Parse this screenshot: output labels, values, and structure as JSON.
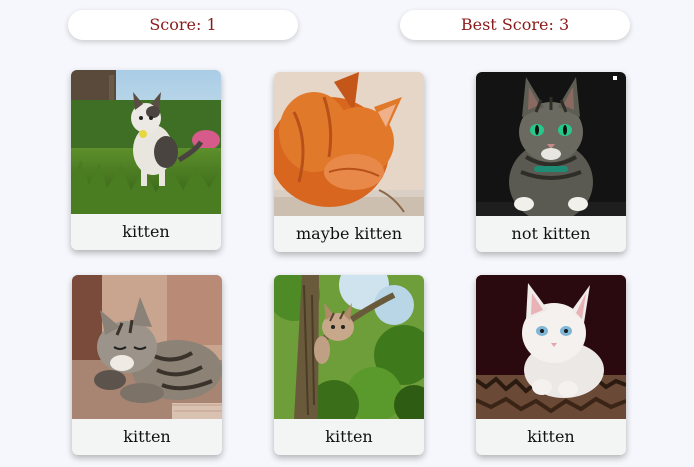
{
  "header": {
    "score_text": "Score: 1",
    "best_score_text": "Best Score: 3"
  },
  "cards": [
    {
      "label": "kitten",
      "image": "kitten-on-grass-photo"
    },
    {
      "label": "maybe kitten",
      "image": "orange-cat-hiding-face-photo"
    },
    {
      "label": "not kitten",
      "image": "tabby-cat-green-eyes-photo"
    },
    {
      "label": "kitten",
      "image": "sleeping-tabby-kitten-photo"
    },
    {
      "label": "kitten",
      "image": "kitten-in-tree-photo"
    },
    {
      "label": "kitten",
      "image": "white-kitten-blue-eyes-photo"
    }
  ],
  "colors": {
    "background": "#f6f7fc",
    "score_text": "#8b1a1a",
    "card_footer": "#f3f5f4"
  }
}
